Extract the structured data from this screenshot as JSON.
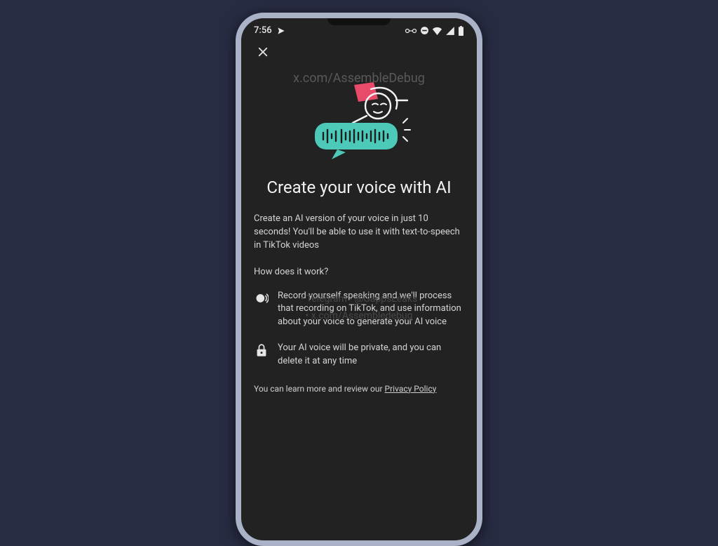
{
  "statusbar": {
    "time": "7:56"
  },
  "watermarks": {
    "top": "x.com/AssembleDebug",
    "mid_line1": "• Telegram - @GappsLeaks",
    "mid_line2": "• x.com/Assembledebug"
  },
  "modal": {
    "title": "Create your voice with AI",
    "description": "Create an AI version of your voice in just 10 seconds! You'll be able to use it with text-to-speech in TikTok videos",
    "subheading": "How does it work?",
    "bullets": [
      {
        "icon": "voice-icon",
        "text": "Record yourself speaking and we'll process that recording on TikTok, and use information about your voice to generate your AI voice"
      },
      {
        "icon": "lock-icon",
        "text": "Your AI voice will be private, and you can delete it at any time"
      }
    ],
    "footer_prefix": "You can learn more and review our ",
    "footer_link": "Privacy Policy"
  },
  "colors": {
    "page_bg": "#282c43",
    "phone_bg": "#222222",
    "frame": "#a9b2c7",
    "accent_teal": "#4cc9b8",
    "accent_pink": "#e84a6a"
  }
}
